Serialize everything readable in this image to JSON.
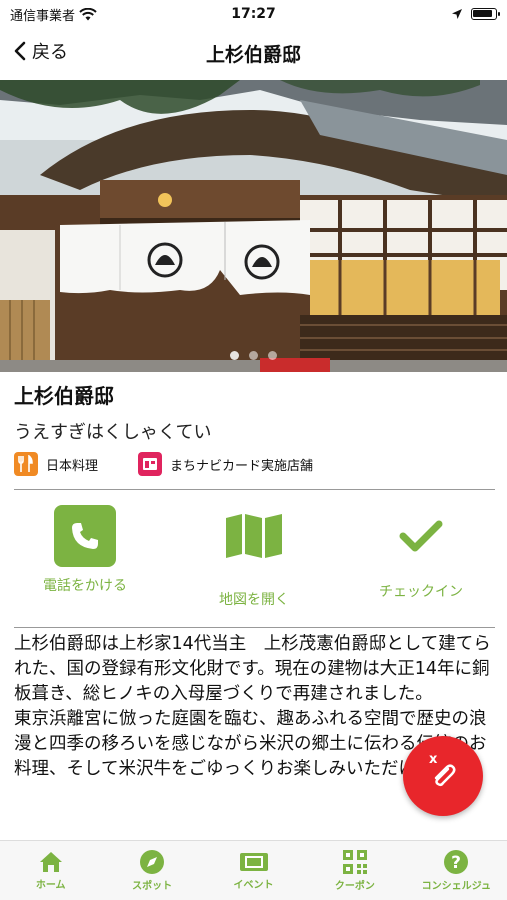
{
  "status_bar": {
    "carrier": "通信事業者",
    "time": "17:27",
    "battery_level": 0.9
  },
  "nav": {
    "back_label": "戻る",
    "title": "上杉伯爵邸"
  },
  "hero": {
    "image_count": 3,
    "active_index": 0
  },
  "place": {
    "name": "上杉伯爵邸",
    "reading": "うえすぎはくしゃくてい"
  },
  "tags": [
    {
      "label": "日本料理",
      "icon": "restaurant-icon",
      "color": "#f08a24"
    },
    {
      "label": "まちナビカード実施店舗",
      "icon": "card-shop-icon",
      "color": "#e0245e"
    }
  ],
  "actions": {
    "call": {
      "label": "電話をかける",
      "icon": "phone-icon"
    },
    "map": {
      "label": "地図を開く",
      "icon": "map-icon"
    },
    "checkin": {
      "label": "チェックイン",
      "icon": "checkmark-icon"
    }
  },
  "description": "上杉伯爵邸は上杉家14代当主　上杉茂憲伯爵邸として建てられた、国の登録有形文化財です。現在の建物は大正14年に銅板葺き、総ヒノキの入母屋づくりで再建されました。\n東京浜離宮に倣った庭園を臨む、趣あふれる空間で歴史の浪漫と四季の移ろいを感じながら米沢の郷土に伝わる伝統のお料理、そして米沢牛をごゆっくりお楽しみいただけます。",
  "fab": {
    "close_label": "x",
    "icon": "paperclip-icon"
  },
  "tab_bar": [
    {
      "label": "ホーム",
      "icon": "home-icon"
    },
    {
      "label": "スポット",
      "icon": "compass-icon"
    },
    {
      "label": "イベント",
      "icon": "ticket-icon"
    },
    {
      "label": "クーポン",
      "icon": "qr-code-icon"
    },
    {
      "label": "コンシェルジュ",
      "icon": "help-icon"
    }
  ],
  "colors": {
    "accent": "#7cb342",
    "fab": "#e8262b"
  }
}
